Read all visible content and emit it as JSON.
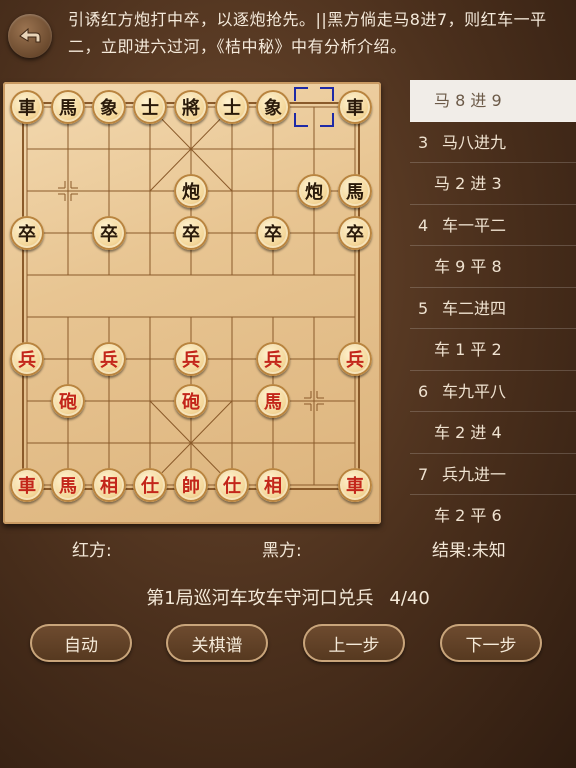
{
  "header": {
    "back_icon": "back-arrow-icon",
    "comment": "引诱红方炮打中卒，以逐炮抢先。||黑方倘走马8进7，则红车一平二，立即进六过河，《桔中秘》中有分析介绍。"
  },
  "board": {
    "pieces": [
      {
        "label": "車",
        "color": "black",
        "col": 0,
        "row": 0
      },
      {
        "label": "馬",
        "color": "black",
        "col": 1,
        "row": 0
      },
      {
        "label": "象",
        "color": "black",
        "col": 2,
        "row": 0
      },
      {
        "label": "士",
        "color": "black",
        "col": 3,
        "row": 0
      },
      {
        "label": "將",
        "color": "black",
        "col": 4,
        "row": 0
      },
      {
        "label": "士",
        "color": "black",
        "col": 5,
        "row": 0
      },
      {
        "label": "象",
        "color": "black",
        "col": 6,
        "row": 0
      },
      {
        "label": "車",
        "color": "black",
        "col": 8,
        "row": 0
      },
      {
        "label": "炮",
        "color": "black",
        "col": 4,
        "row": 2
      },
      {
        "label": "炮",
        "color": "black",
        "col": 7,
        "row": 2
      },
      {
        "label": "馬",
        "color": "black",
        "col": 8,
        "row": 2
      },
      {
        "label": "卒",
        "color": "black",
        "col": 0,
        "row": 3
      },
      {
        "label": "卒",
        "color": "black",
        "col": 2,
        "row": 3
      },
      {
        "label": "卒",
        "color": "black",
        "col": 4,
        "row": 3
      },
      {
        "label": "卒",
        "color": "black",
        "col": 6,
        "row": 3
      },
      {
        "label": "卒",
        "color": "black",
        "col": 8,
        "row": 3
      },
      {
        "label": "兵",
        "color": "red",
        "col": 0,
        "row": 6
      },
      {
        "label": "兵",
        "color": "red",
        "col": 2,
        "row": 6
      },
      {
        "label": "兵",
        "color": "red",
        "col": 4,
        "row": 6
      },
      {
        "label": "兵",
        "color": "red",
        "col": 6,
        "row": 6
      },
      {
        "label": "兵",
        "color": "red",
        "col": 8,
        "row": 6
      },
      {
        "label": "砲",
        "color": "red",
        "col": 1,
        "row": 7
      },
      {
        "label": "砲",
        "color": "red",
        "col": 4,
        "row": 7
      },
      {
        "label": "馬",
        "color": "red",
        "col": 6,
        "row": 7
      },
      {
        "label": "車",
        "color": "red",
        "col": 0,
        "row": 9
      },
      {
        "label": "馬",
        "color": "red",
        "col": 1,
        "row": 9
      },
      {
        "label": "相",
        "color": "red",
        "col": 2,
        "row": 9
      },
      {
        "label": "仕",
        "color": "red",
        "col": 3,
        "row": 9
      },
      {
        "label": "帥",
        "color": "red",
        "col": 4,
        "row": 9
      },
      {
        "label": "仕",
        "color": "red",
        "col": 5,
        "row": 9
      },
      {
        "label": "相",
        "color": "red",
        "col": 6,
        "row": 9
      },
      {
        "label": "車",
        "color": "red",
        "col": 8,
        "row": 9
      }
    ],
    "last_move_from": {
      "col": 7,
      "row": 0
    }
  },
  "moves": [
    {
      "num": "",
      "text": "马 8 进 9",
      "selected": true
    },
    {
      "num": "3",
      "text": "马八进九",
      "selected": false
    },
    {
      "num": "",
      "text": "马 2 进 3",
      "selected": false
    },
    {
      "num": "4",
      "text": "车一平二",
      "selected": false
    },
    {
      "num": "",
      "text": "车 9 平 8",
      "selected": false
    },
    {
      "num": "5",
      "text": "车二进四",
      "selected": false
    },
    {
      "num": "",
      "text": "车 1 平 2",
      "selected": false
    },
    {
      "num": "6",
      "text": "车九平八",
      "selected": false
    },
    {
      "num": "",
      "text": "车 2 进 4",
      "selected": false
    },
    {
      "num": "7",
      "text": "兵九进一",
      "selected": false
    },
    {
      "num": "",
      "text": "车 2 平 6",
      "selected": false
    }
  ],
  "players": {
    "red_label": "红方:",
    "black_label": "黑方:",
    "result_label": "结果:未知"
  },
  "game": {
    "title": "第1局巡河车攻车守河口兑兵",
    "progress": "4/40"
  },
  "buttons": {
    "auto": "自动",
    "close_record": "关棋谱",
    "prev": "上一步",
    "next": "下一步"
  }
}
